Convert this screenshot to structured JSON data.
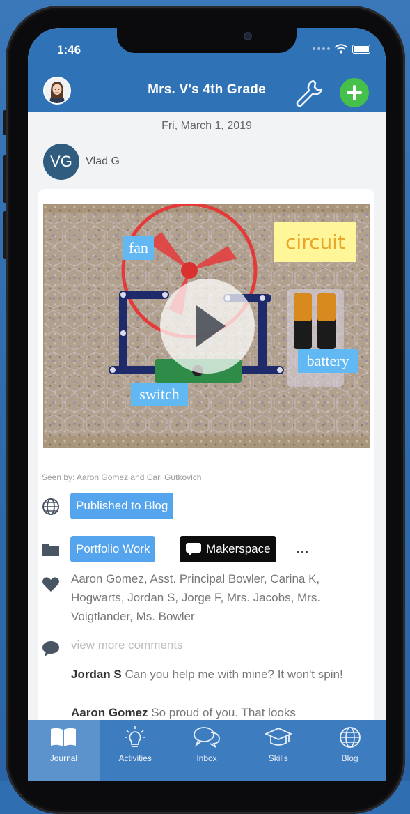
{
  "status_bar": {
    "time": "1:46"
  },
  "header": {
    "title": "Mrs. V's 4th Grade"
  },
  "post": {
    "date": "Fri, March 1, 2019",
    "author_initials": "VG",
    "author_name": "Vlad G",
    "photo_labels": {
      "fan": "fan",
      "circuit": "circuit",
      "battery": "battery",
      "switch": "switch"
    },
    "seen_by": "Seen by: Aaron Gomez and Carl Gutkovich",
    "published_chip": "Published to Blog",
    "folder_chips": [
      "Portfolio Work",
      "Makerspace"
    ],
    "more": "...",
    "likes": "Aaron Gomez, Asst. Principal Bowler, Carina K, Hogwarts, Jordan S, Jorge F, Mrs. Jacobs, Mrs. Voigtlander, Ms. Bowler",
    "view_more": "view more comments",
    "comments": [
      {
        "author": "Jordan S",
        "text": "Can you help me with mine? It won't spin!"
      },
      {
        "author": "Aaron Gomez",
        "text": "So proud of you. That looks"
      }
    ]
  },
  "tabs": [
    {
      "label": "Journal",
      "icon": "journal-icon"
    },
    {
      "label": "Activities",
      "icon": "lightbulb-icon"
    },
    {
      "label": "Inbox",
      "icon": "chat-bubbles-icon"
    },
    {
      "label": "Skills",
      "icon": "graduation-cap-icon"
    },
    {
      "label": "Blog",
      "icon": "globe-icon"
    }
  ],
  "colors": {
    "header": "#2f72b6",
    "add_button": "#45c04a",
    "chip_blue": "#55a4ee",
    "tabbar": "#3e7cc0"
  }
}
